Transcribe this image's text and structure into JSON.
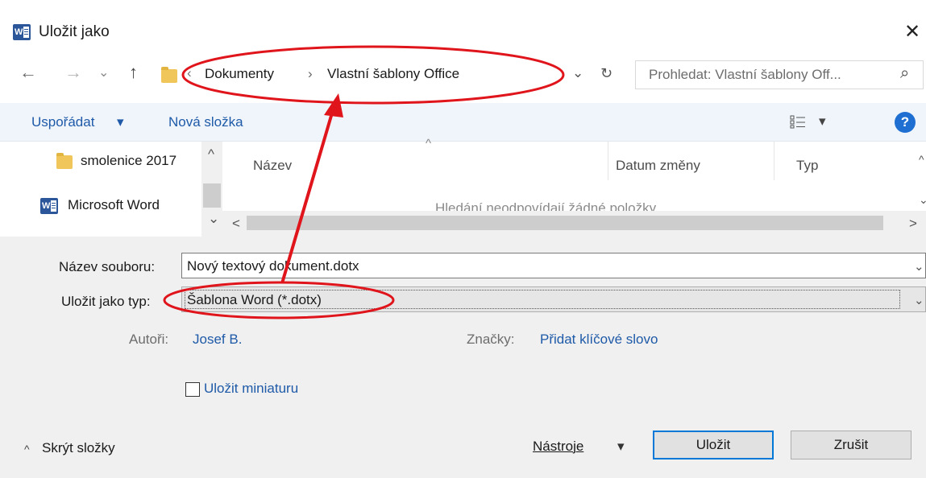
{
  "title_bar": {
    "title": "Uložit jako",
    "close_glyph": "✕",
    "app_icon": "word-icon"
  },
  "nav": {
    "back_glyph": "←",
    "forward_glyph": "→",
    "recent_glyph": "⌄",
    "up_glyph": "↑",
    "breadcrumb": [
      {
        "label": "Dokumenty"
      },
      {
        "label": "Vlastní šablony Office"
      }
    ],
    "breadcrumb_prefix": "‹",
    "separator": "›",
    "dropdown_glyph": "⌄",
    "refresh_glyph": "↻",
    "search_placeholder": "Prohledat: Vlastní šablony Off...",
    "search_glyph": "⌕"
  },
  "toolbar": {
    "organize_label": "Uspořádat",
    "organize_glyph": "▾",
    "new_folder_label": "Nová složka",
    "view_glyph": "▾",
    "help_glyph": "?"
  },
  "nav_pane": {
    "items": [
      {
        "label": "smolenice 2017",
        "icon": "folder-icon"
      },
      {
        "label": "Microsoft Word",
        "icon": "word-icon"
      }
    ],
    "scroll_up_glyph": "^",
    "scroll_down_glyph": "⌄"
  },
  "file_list": {
    "columns": [
      "Název",
      "Datum změny",
      "Typ"
    ],
    "sort_glyph": "^",
    "empty_message": "Hledání neodpovídají žádné položky.",
    "scroll_left_glyph": "<",
    "scroll_right_glyph": ">"
  },
  "form": {
    "filename_label": "Název souboru:",
    "filename_value": "Nový textový dokument.dotx",
    "type_label": "Uložit jako typ:",
    "type_value": "Šablona Word (*.dotx)",
    "authors_label": "Autoři:",
    "authors_value": "Josef B.",
    "tags_label": "Značky:",
    "tags_value": "Přidat klíčové slovo",
    "thumbnail_label": "Uložit miniaturu",
    "thumbnail_checked": false
  },
  "footer": {
    "hide_folders_label": "Skrýt složky",
    "hide_folders_glyph": "^",
    "tools_label": "Nástroje",
    "tools_glyph": "▾",
    "save_label": "Uložit",
    "cancel_label": "Zrušit"
  },
  "colors": {
    "annotation_red": "#e0141b",
    "link_blue": "#1e5aa8",
    "toolbar_bg": "#f0f5fb",
    "form_bg": "#f0f0f0"
  }
}
